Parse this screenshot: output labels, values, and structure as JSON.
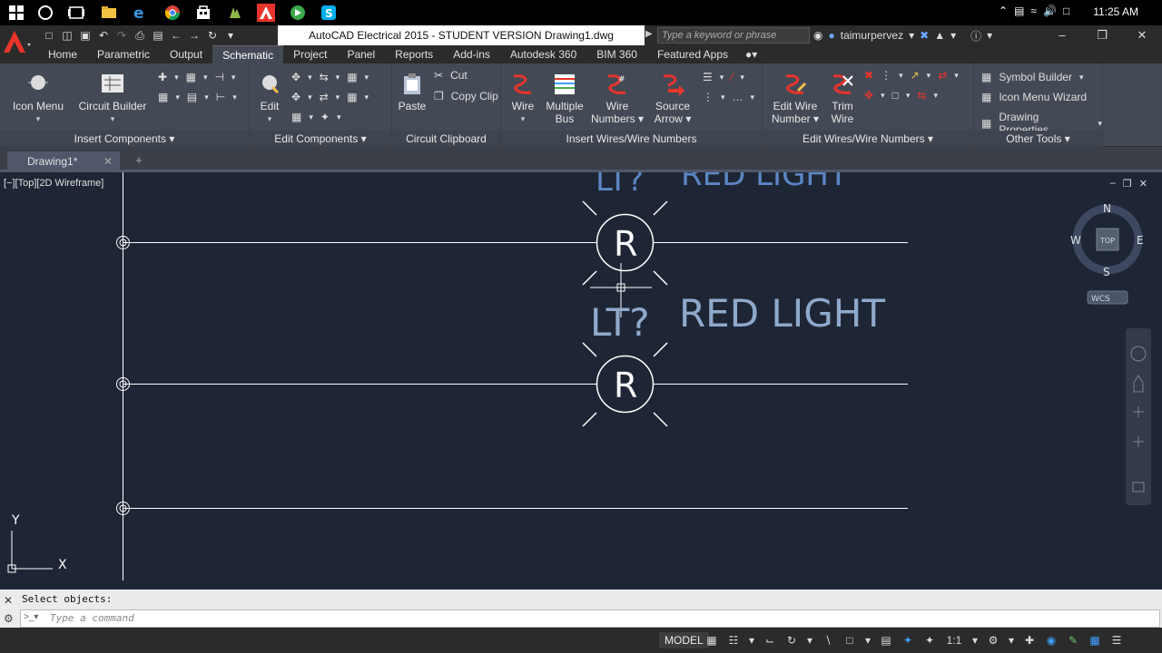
{
  "taskbar": {
    "clock": "11:25 AM",
    "icons": [
      "windows-icon",
      "cortana-icon",
      "task-view-icon",
      "file-explorer-icon",
      "edge-icon",
      "chrome-icon",
      "store-icon",
      "app-icon",
      "autocad-icon",
      "camtasia-icon",
      "skype-icon"
    ]
  },
  "titlebar": {
    "title": "AutoCAD Electrical 2015 - STUDENT VERSION    Drawing1.dwg",
    "search_placeholder": "Type a keyword or phrase",
    "username": "taimurpervez"
  },
  "ribbon_tabs": [
    {
      "label": "Home",
      "active": false
    },
    {
      "label": "Parametric",
      "active": false
    },
    {
      "label": "Output",
      "active": false
    },
    {
      "label": "Schematic",
      "active": true
    },
    {
      "label": "Project",
      "active": false
    },
    {
      "label": "Panel",
      "active": false
    },
    {
      "label": "Reports",
      "active": false
    },
    {
      "label": "Add-ins",
      "active": false
    },
    {
      "label": "Autodesk 360",
      "active": false
    },
    {
      "label": "BIM 360",
      "active": false
    },
    {
      "label": "Featured Apps",
      "active": false
    }
  ],
  "ribbon": {
    "insert_components": {
      "title": "Insert Components",
      "icon_menu": "Icon Menu",
      "circuit_builder": "Circuit Builder"
    },
    "edit_components": {
      "title": "Edit Components",
      "edit": "Edit"
    },
    "circuit_clipboard": {
      "title": "Circuit Clipboard",
      "paste": "Paste",
      "cut": "Cut",
      "copy_clip": "Copy Clip"
    },
    "insert_wires": {
      "title": "Insert Wires/Wire Numbers",
      "wire": "Wire",
      "multiple_bus_1": "Multiple",
      "multiple_bus_2": "Bus",
      "wire_numbers_1": "Wire",
      "wire_numbers_2": "Numbers",
      "source_arrow_1": "Source",
      "source_arrow_2": "Arrow"
    },
    "edit_wires": {
      "title": "Edit Wires/Wire Numbers",
      "edit_wire_number_1": "Edit Wire",
      "edit_wire_number_2": "Number",
      "trim_wire_1": "Trim",
      "trim_wire_2": "Wire"
    },
    "other_tools": {
      "title": "Other Tools",
      "symbol_builder": "Symbol Builder",
      "icon_menu_wizard": "Icon Menu  Wizard",
      "drawing_properties": "Drawing  Properties"
    }
  },
  "file_tab": {
    "label": "Drawing1*"
  },
  "viewport": {
    "label": "[−][Top][2D Wireframe]"
  },
  "drawing": {
    "top_partial_tag": "LT?",
    "top_partial_desc": "RED  LIGHT",
    "lamp_letter": "R",
    "tag": "LT?",
    "desc": "RED  LIGHT",
    "ucs_x": "X",
    "ucs_y": "Y"
  },
  "viewcube": {
    "n": "N",
    "s": "S",
    "e": "E",
    "w": "W",
    "top": "TOP",
    "wcs": "WCS"
  },
  "command": {
    "history": "Select objects:",
    "placeholder": "Type a command"
  },
  "status": {
    "model": "MODEL",
    "scale": "1:1"
  },
  "colors": {
    "canvas": "#1e2635",
    "wire": "#ffffff",
    "text_blue": "#8fa9cc",
    "ribbon": "#444a55",
    "accent": "#3fa0ff",
    "autocad_red": "#e8342a"
  }
}
